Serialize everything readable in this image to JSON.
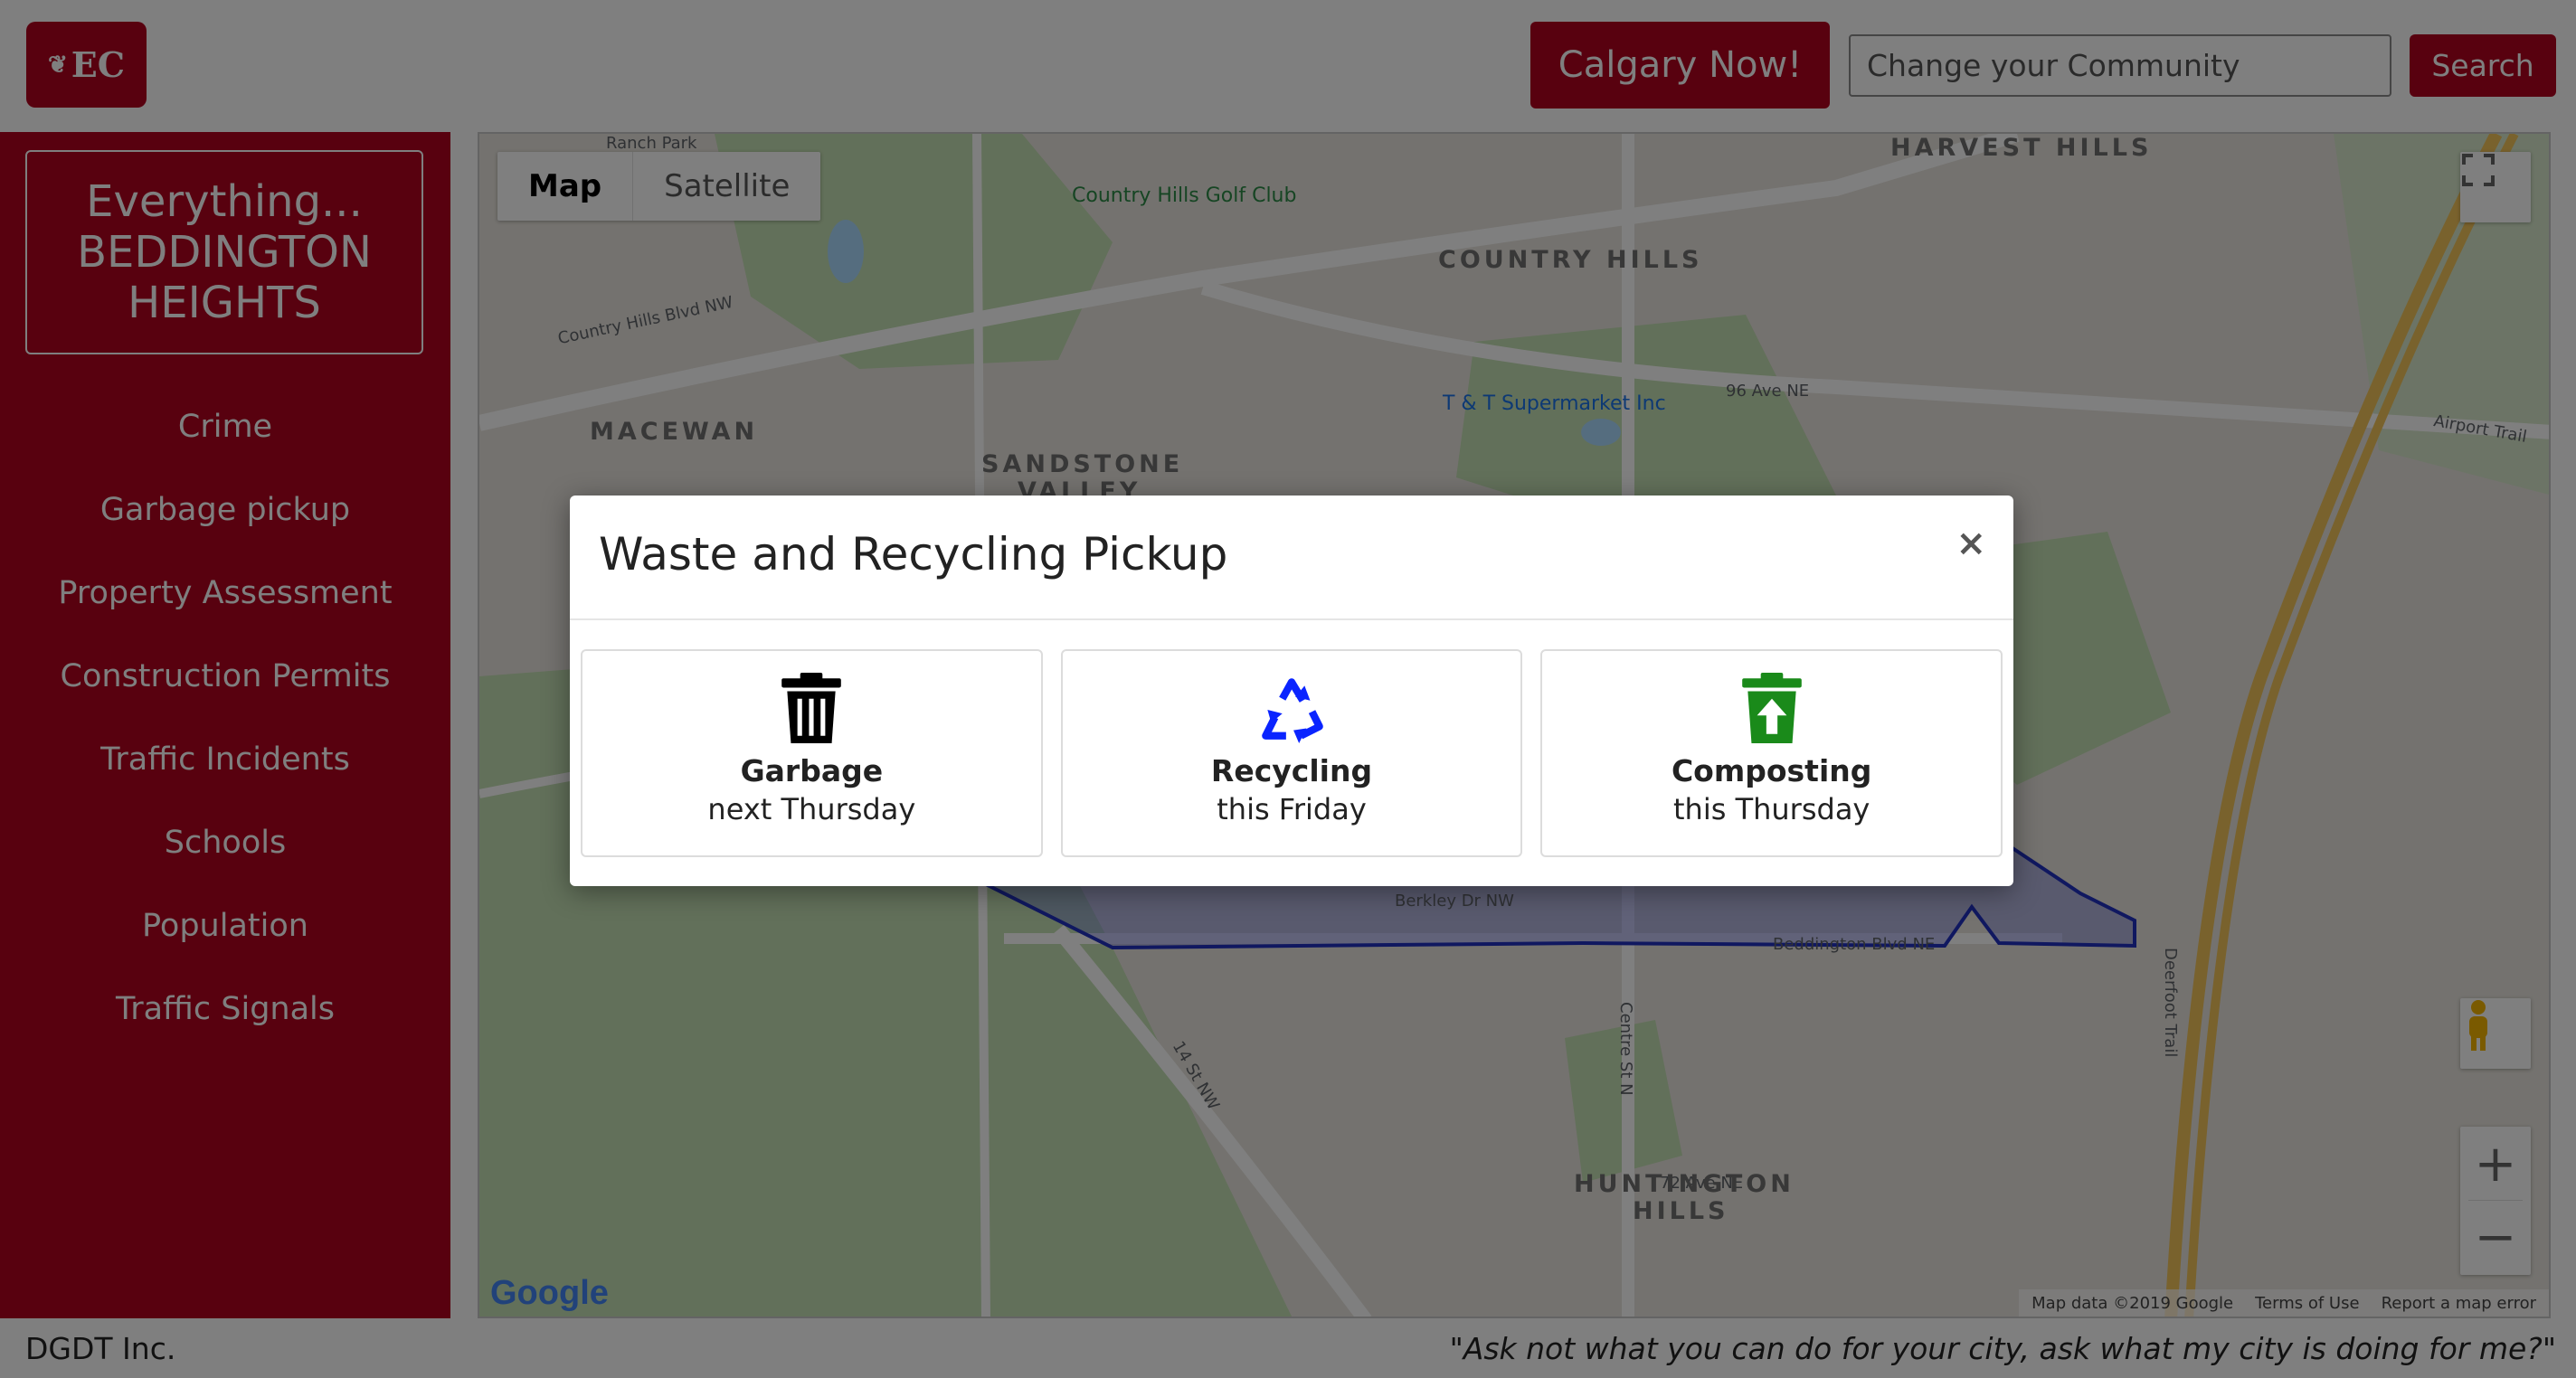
{
  "header": {
    "logo_text": "EC",
    "calgary_now_label": "Calgary Now!",
    "search_placeholder": "Change your Community",
    "search_button_label": "Search"
  },
  "sidebar": {
    "title_line1": "Everything...",
    "title_line2": "BEDDINGTON",
    "title_line3": "HEIGHTS",
    "items": [
      {
        "label": "Crime"
      },
      {
        "label": "Garbage pickup"
      },
      {
        "label": "Property Assessment"
      },
      {
        "label": "Construction Permits"
      },
      {
        "label": "Traffic Incidents"
      },
      {
        "label": "Schools"
      },
      {
        "label": "Population"
      },
      {
        "label": "Traffic Signals"
      }
    ]
  },
  "map": {
    "type_tabs": [
      "Map",
      "Satellite"
    ],
    "active_tab": "Map",
    "labels": {
      "ranch_park": "Ranch Park",
      "harvest_hills": "HARVEST HILLS",
      "country_hills_golf": "Country Hills Golf Club",
      "country_hills": "COUNTRY HILLS",
      "macewan": "MACEWAN",
      "sandstone": "SANDSTONE",
      "valley": "VALLEY",
      "tt_supermarket": "T & T Supermarket Inc",
      "ave96": "96 Ave NE",
      "airport_trail": "Airport Trail",
      "huntington": "HUNTINGTON",
      "hills": "HILLS",
      "deerfoot": "Deerfoot Trail",
      "beddington_blvd": "Beddington Blvd NE",
      "berkley": "Berkley Dr NW",
      "centre_st": "Centre St N",
      "st14": "14 St NW",
      "ave72": "72 Ave NE",
      "country_hills_blvd": "Country Hills Blvd NW"
    },
    "google_logo": "Google",
    "footer": {
      "map_data": "Map data ©2019 Google",
      "terms": "Terms of Use",
      "report": "Report a map error"
    },
    "icons": {
      "fullscreen": "fullscreen-icon",
      "pegman": "pegman-icon",
      "zoom_in": "zoom-in-icon",
      "zoom_out": "zoom-out-icon"
    }
  },
  "modal": {
    "title": "Waste and Recycling Pickup",
    "close_glyph": "×",
    "cards": [
      {
        "name": "Garbage",
        "when": "next Thursday",
        "icon": "trash-icon",
        "color": "#000000"
      },
      {
        "name": "Recycling",
        "when": "this Friday",
        "icon": "recycle-icon",
        "color": "#0a24ff"
      },
      {
        "name": "Composting",
        "when": "this Thursday",
        "icon": "compost-bin-icon",
        "color": "#1a8a1a"
      }
    ]
  },
  "footer": {
    "company": "DGDT Inc.",
    "quote": "\"Ask not what you can do for your city, ask what my city is doing for me?\""
  },
  "colors": {
    "brand": "#b0021e",
    "overlay": "rgba(0,0,0,0.5)"
  }
}
